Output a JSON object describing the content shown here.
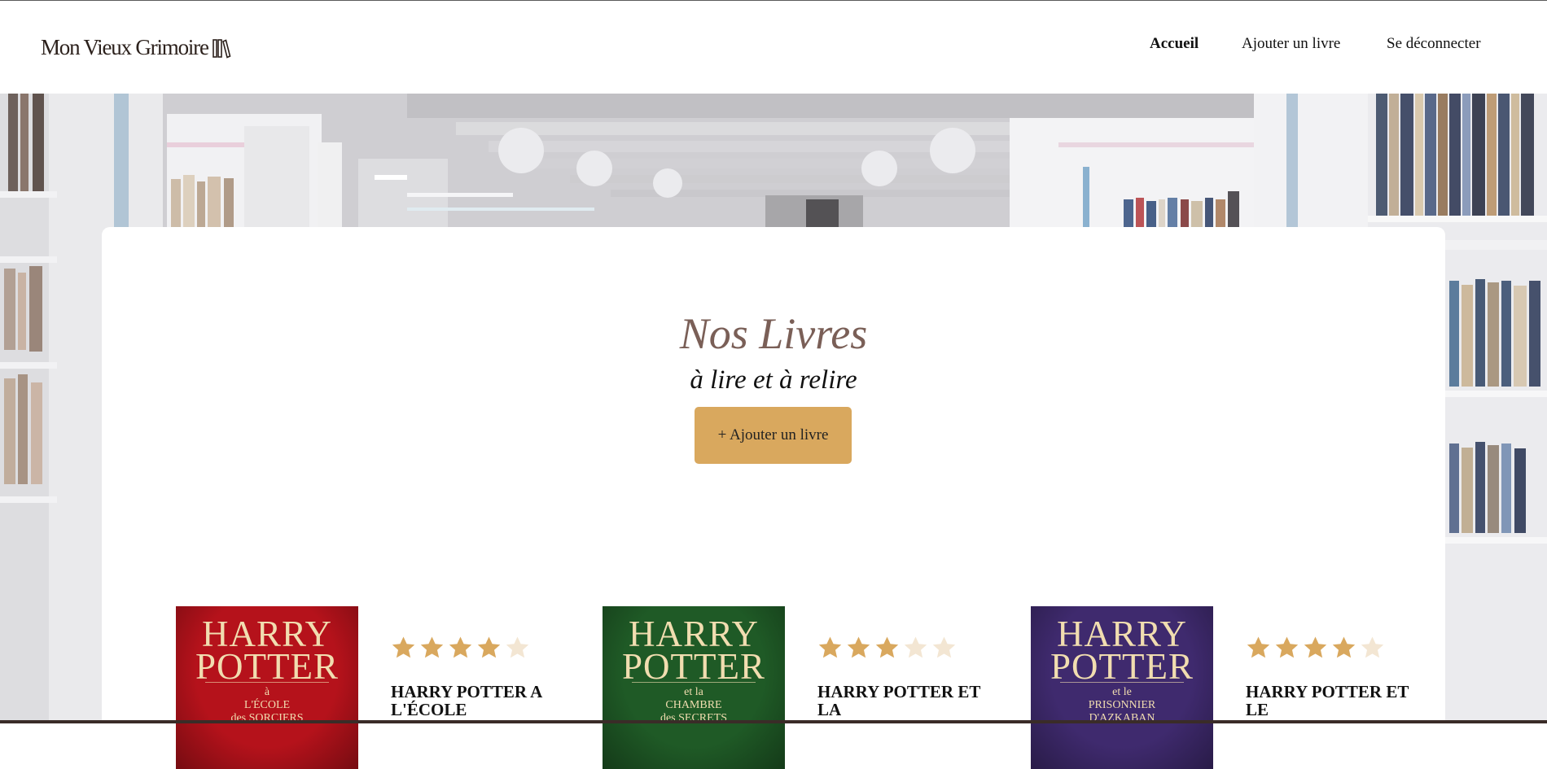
{
  "header": {
    "logo_text": "Mon Vieux Grimoire",
    "logo_icon": "books-icon",
    "nav": [
      {
        "label": "Accueil",
        "active": true
      },
      {
        "label": "Ajouter un livre",
        "active": false
      },
      {
        "label": "Se déconnecter",
        "active": false
      }
    ]
  },
  "hero": {
    "title": "Nos Livres",
    "subtitle": "à lire et à relire",
    "add_button": "+ Ajouter un livre"
  },
  "books": [
    {
      "cover_title_1": "HARRY",
      "cover_title_2": "POTTER",
      "cover_subtitle": "à\nL'ÉCOLE\ndes SORCIERS",
      "cover_color": "#b5121b",
      "rating": 4,
      "title": "HARRY POTTER A L'ÉCOLE"
    },
    {
      "cover_title_1": "HARRY",
      "cover_title_2": "POTTER",
      "cover_subtitle": "et la\nCHAMBRE\ndes SECRETS",
      "cover_color": "#1f5a26",
      "rating": 3,
      "title": "HARRY POTTER ET LA"
    },
    {
      "cover_title_1": "HARRY",
      "cover_title_2": "POTTER",
      "cover_subtitle": "et le\nPRISONNIER\nD'AZKABAN",
      "cover_color": "#3f2a6e",
      "rating": 4,
      "title": "HARRY POTTER ET LE"
    }
  ],
  "colors": {
    "accent": "#d9a85e",
    "star_filled": "#d9a85e",
    "star_empty": "#f3e6d3",
    "title": "#7a5f57"
  }
}
